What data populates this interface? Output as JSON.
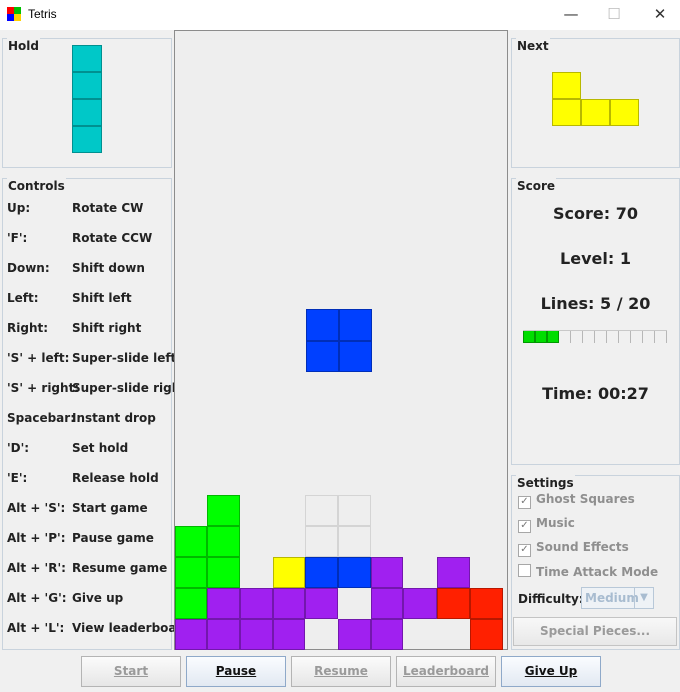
{
  "window": {
    "title": "Tetris",
    "minimize_glyph": "—",
    "maximize_glyph": "☐",
    "close_glyph": "✕"
  },
  "hold": {
    "title": "Hold",
    "piece": "I",
    "color": "#00c8c8"
  },
  "controls": {
    "title": "Controls",
    "rows": [
      {
        "key": "Up:",
        "action": "Rotate CW"
      },
      {
        "key": "'F':",
        "action": "Rotate CCW"
      },
      {
        "key": "Down:",
        "action": "Shift down"
      },
      {
        "key": "Left:",
        "action": "Shift left"
      },
      {
        "key": "Right:",
        "action": "Shift right"
      },
      {
        "key": "'S' + left:",
        "action": "Super-slide left"
      },
      {
        "key": "'S' + right:",
        "action": "Super-slide right"
      },
      {
        "key": "Spacebar:",
        "action": "Instant drop"
      },
      {
        "key": "'D':",
        "action": "Set hold"
      },
      {
        "key": "'E':",
        "action": "Release hold"
      },
      {
        "key": "Alt + 'S':",
        "action": "Start game"
      },
      {
        "key": "Alt + 'P':",
        "action": "Pause game"
      },
      {
        "key": "Alt + 'R':",
        "action": "Resume game"
      },
      {
        "key": "Alt + 'G':",
        "action": "Give up"
      },
      {
        "key": "Alt + 'L':",
        "action": "View leaderboard"
      }
    ]
  },
  "next": {
    "title": "Next",
    "piece": "L",
    "color": "#ffff00"
  },
  "score": {
    "title": "Score",
    "score_text": "Score: 70",
    "level_text": "Level: 1",
    "lines_text": "Lines: 5 / 20",
    "lines_done": 5,
    "lines_goal": 20,
    "time_text": "Time: 00:27"
  },
  "settings": {
    "title": "Settings",
    "ghost_squares": {
      "label": "Ghost Squares",
      "checked": true
    },
    "music": {
      "label": "Music",
      "checked": true
    },
    "sound_effects": {
      "label": "Sound Effects",
      "checked": true
    },
    "time_attack": {
      "label": "Time Attack Mode",
      "checked": false
    },
    "difficulty_label": "Difficulty:",
    "difficulty_value": "Medium",
    "special_pieces_label": "Special Pieces..."
  },
  "buttons": {
    "start": "Start",
    "pause": "Pause",
    "resume": "Resume",
    "leaderboard": "Leaderboard",
    "give_up": "Give Up"
  },
  "colors": {
    "cyan": "#00c8c8",
    "yellow": "#ffff00",
    "blue": "#0040ff",
    "green": "#00ff00",
    "purple": "#a020f0",
    "red": "#ff2000",
    "ghost": "#d4d4d4"
  },
  "board": {
    "active_piece": {
      "type": "O",
      "color": "#0040ff"
    }
  }
}
